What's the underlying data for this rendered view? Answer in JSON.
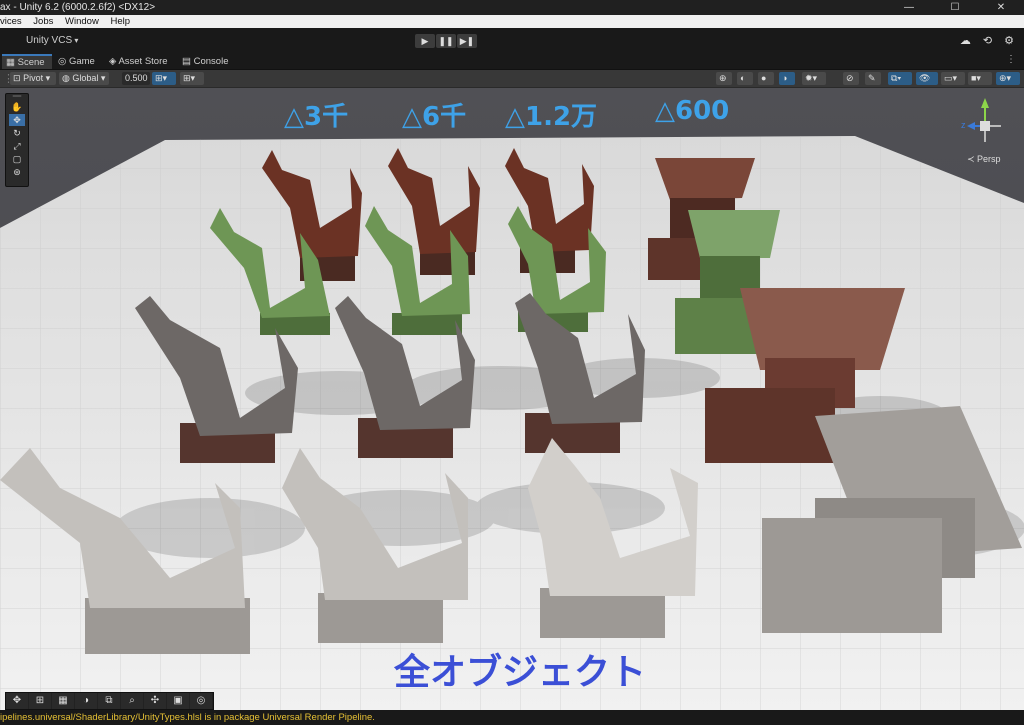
{
  "window": {
    "title": "ax - Unity 6.2 (6000.2.6f2) <DX12>",
    "buttons": [
      "—",
      "☐",
      "✕"
    ]
  },
  "menu": [
    "vices",
    "Jobs",
    "Window",
    "Help"
  ],
  "toolbar": {
    "vcs_label": "Unity VCS",
    "play": "▶",
    "pause": "❚❚",
    "step": "▶❚"
  },
  "tabs": [
    {
      "label": "Scene",
      "icon": "scene-icon"
    },
    {
      "label": "Game",
      "icon": "game-icon"
    },
    {
      "label": "Asset Store",
      "icon": "store-icon"
    },
    {
      "label": "Console",
      "icon": "console-icon"
    }
  ],
  "scene_toolbar": {
    "pivot": "Pivot",
    "global": "Global",
    "snap_value": "0.500"
  },
  "overlay": {
    "labels": [
      "△3千",
      "△6千",
      "△1.2万",
      "△600"
    ],
    "bottom_label": "全オブジェクト",
    "persp_label": "≺ Persp",
    "gizmo_z": "z"
  },
  "status": {
    "message": "ipelines.universal/ShaderLibrary/UnityTypes.hlsl is in package Universal Render Pipeline."
  },
  "colors": {
    "label_blue": "#3ea2e8",
    "bottom_label_blue": "#3b4fd6",
    "status_yellow": "#e5c035",
    "accent": "#3a79bb"
  }
}
